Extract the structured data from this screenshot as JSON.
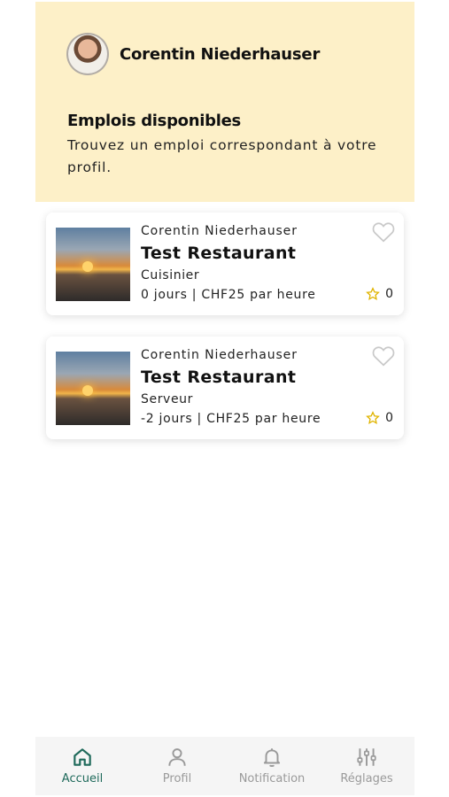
{
  "header": {
    "username": "Corentin Niederhauser",
    "title": "Emplois disponibles",
    "subtitle": "Trouvez un emploi correspondant à votre profil."
  },
  "jobs": [
    {
      "author": "Corentin Niederhauser",
      "title": "Test Restaurant",
      "role": "Cuisinier",
      "meta": "0 jours | CHF25 par heure",
      "rating": "0"
    },
    {
      "author": "Corentin Niederhauser",
      "title": "Test Restaurant",
      "role": "Serveur",
      "meta": "-2 jours | CHF25 par heure",
      "rating": "0"
    }
  ],
  "nav": {
    "home": "Accueil",
    "profile": "Profil",
    "notification": "Notification",
    "settings": "Réglages"
  },
  "colors": {
    "header_bg": "#fdf0c8",
    "active_nav": "#1f6a5b",
    "inactive_nav": "#9a9a9a",
    "star": "#e0b400"
  },
  "icons": [
    "heart-icon",
    "star-icon",
    "home-icon",
    "user-icon",
    "bell-icon",
    "sliders-icon"
  ]
}
